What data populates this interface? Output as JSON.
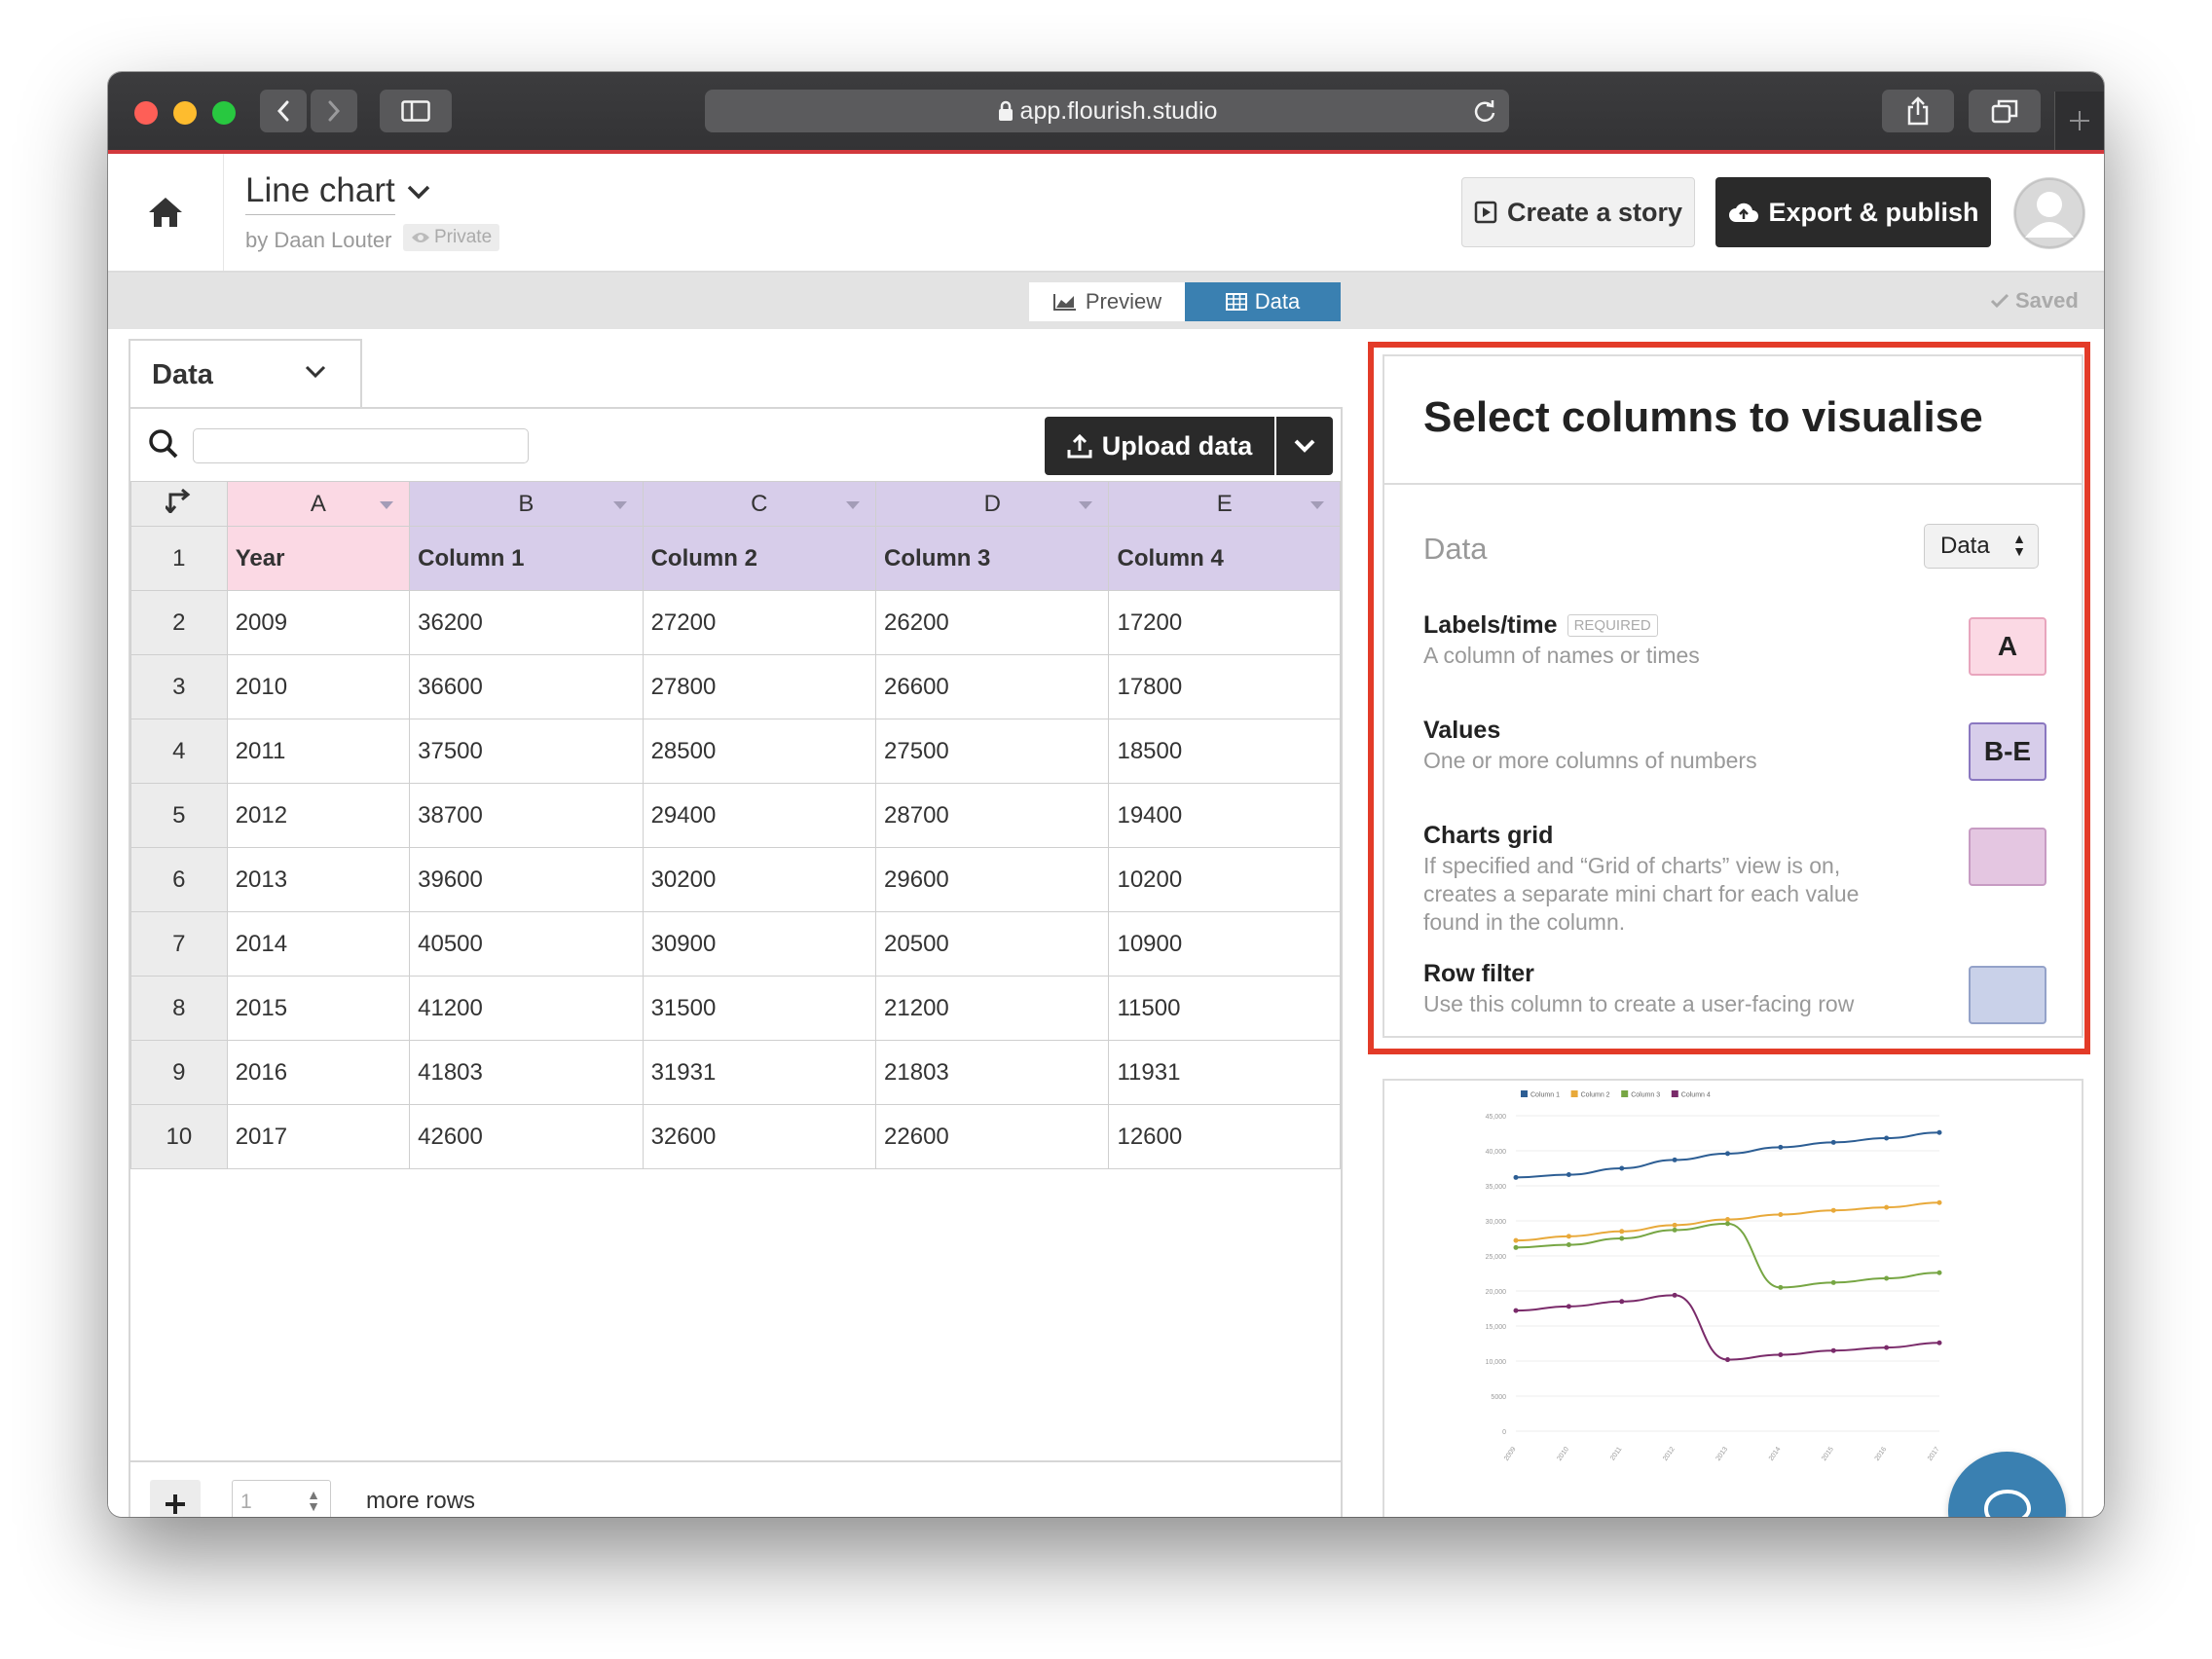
{
  "browser": {
    "url": "app.flourish.studio"
  },
  "header": {
    "title": "Line chart",
    "byline": "by Daan Louter",
    "privacy": "Private",
    "story_button": "Create a story",
    "export_button": "Export & publish"
  },
  "tabs": {
    "preview": "Preview",
    "data": "Data",
    "saved": "Saved"
  },
  "sheet": {
    "tab_label": "Data",
    "upload_label": "Upload data",
    "columns": [
      "A",
      "B",
      "C",
      "D",
      "E"
    ],
    "header_row": [
      "Year",
      "Column 1",
      "Column 2",
      "Column 3",
      "Column 4"
    ],
    "rows": [
      [
        "2009",
        "36200",
        "27200",
        "26200",
        "17200"
      ],
      [
        "2010",
        "36600",
        "27800",
        "26600",
        "17800"
      ],
      [
        "2011",
        "37500",
        "28500",
        "27500",
        "18500"
      ],
      [
        "2012",
        "38700",
        "29400",
        "28700",
        "19400"
      ],
      [
        "2013",
        "39600",
        "30200",
        "29600",
        "10200"
      ],
      [
        "2014",
        "40500",
        "30900",
        "20500",
        "10900"
      ],
      [
        "2015",
        "41200",
        "31500",
        "21200",
        "11500"
      ],
      [
        "2016",
        "41803",
        "31931",
        "21803",
        "11931"
      ],
      [
        "2017",
        "42600",
        "32600",
        "22600",
        "12600"
      ]
    ],
    "row_numbers": [
      "1",
      "2",
      "3",
      "4",
      "5",
      "6",
      "7",
      "8",
      "9",
      "10"
    ],
    "add_rows_count": "1",
    "more_rows_label": "more rows"
  },
  "panel": {
    "heading": "Select columns to visualise",
    "data_label": "Data",
    "data_select": "Data",
    "required_tag": "REQUIRED",
    "bindings": [
      {
        "name": "Labels/time",
        "desc": "A column of names or times",
        "value": "A",
        "color": "#fbd9e4",
        "border": "#e8a5bd"
      },
      {
        "name": "Values",
        "desc": "One or more columns of numbers",
        "value": "B-E",
        "color": "#d7cdea",
        "border": "#8a77c0"
      },
      {
        "name": "Charts grid",
        "desc": "If specified and “Grid of charts” view is on, creates a separate mini chart for each value found in the column.",
        "value": "",
        "color": "#e4c6e1",
        "border": "#c79bc3"
      },
      {
        "name": "Row filter",
        "desc": "Use this column to create a user-facing row",
        "value": "",
        "color": "#c9d1e9",
        "border": "#94a2c9"
      }
    ]
  },
  "chart_data": {
    "type": "line",
    "x": [
      "2009",
      "2010",
      "2011",
      "2012",
      "2013",
      "2014",
      "2015",
      "2016",
      "2017"
    ],
    "series": [
      {
        "name": "Column 1",
        "color": "#2d5e94",
        "values": [
          36200,
          36600,
          37500,
          38700,
          39600,
          40500,
          41200,
          41803,
          42600
        ]
      },
      {
        "name": "Column 2",
        "color": "#e8a93a",
        "values": [
          27200,
          27800,
          28500,
          29400,
          30200,
          30900,
          31500,
          31931,
          32600
        ]
      },
      {
        "name": "Column 3",
        "color": "#77a644",
        "values": [
          26200,
          26600,
          27500,
          28700,
          29600,
          20500,
          21200,
          21803,
          22600
        ]
      },
      {
        "name": "Column 4",
        "color": "#7a2b6a",
        "values": [
          17200,
          17800,
          18500,
          19400,
          10200,
          10900,
          11500,
          11931,
          12600
        ]
      }
    ],
    "yticks": [
      "0",
      "5000",
      "10,000",
      "15,000",
      "20,000",
      "25,000",
      "30,000",
      "35,000",
      "40,000",
      "45,000"
    ],
    "ylim": [
      0,
      45000
    ],
    "legend": "top-left",
    "grid": true
  },
  "colors": {
    "accent": "#3a80b1",
    "highlight": "#e33b28",
    "labels_column": "#fbd9e4",
    "values_column": "#d7cdea"
  }
}
